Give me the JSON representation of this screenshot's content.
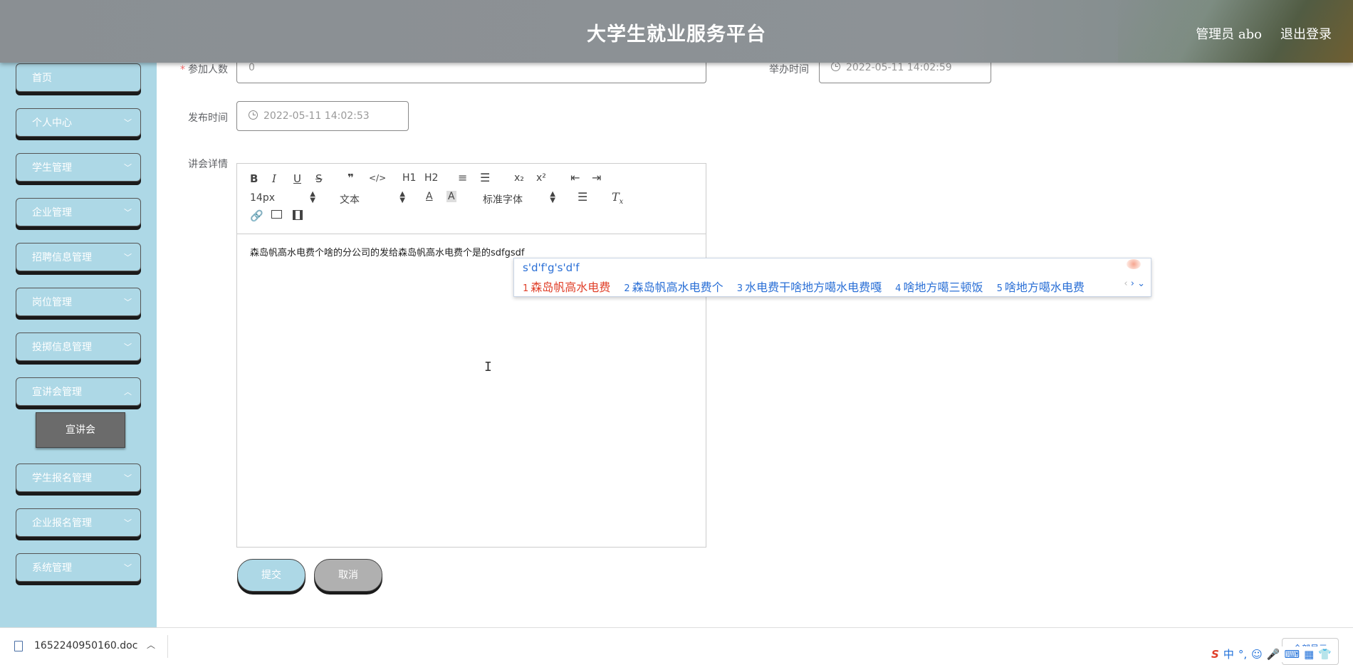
{
  "header": {
    "title": "大学生就业服务平台",
    "user": "管理员 abo",
    "logout": "退出登录"
  },
  "sidebar": {
    "items": [
      {
        "label": "首页",
        "has_chevron": false
      },
      {
        "label": "个人中心",
        "has_chevron": true
      },
      {
        "label": "学生管理",
        "has_chevron": true
      },
      {
        "label": "企业管理",
        "has_chevron": true
      },
      {
        "label": "招聘信息管理",
        "has_chevron": true
      },
      {
        "label": "岗位管理",
        "has_chevron": true
      },
      {
        "label": "投掷信息管理",
        "has_chevron": true
      },
      {
        "label": "宣讲会管理",
        "has_chevron": true
      },
      {
        "label": "学生报名管理",
        "has_chevron": true
      },
      {
        "label": "企业报名管理",
        "has_chevron": true
      },
      {
        "label": "系统管理",
        "has_chevron": true
      }
    ],
    "active_submenu": "宣讲会"
  },
  "form": {
    "participants": {
      "label": "参加人数",
      "required_mark": "*",
      "value": "0"
    },
    "hold_time": {
      "label": "举办时间",
      "value": "2022-05-11 14:02:59"
    },
    "publish_time": {
      "label": "发布时间",
      "value": "2022-05-11 14:02:53"
    },
    "details": {
      "label": "讲会详情"
    }
  },
  "editor": {
    "toolbar": {
      "row1": [
        "B",
        "I",
        "U",
        "S",
        "❞",
        "</>",
        "H1",
        "H2",
        "≡",
        "☰",
        "x₂",
        "x²",
        "⇤",
        "⇥"
      ],
      "font_size": "14px",
      "block_format": "文本",
      "font_family": "标准字体"
    },
    "content": "森岛帆高水电费个啥的分公司的发给森岛帆高水电费个是的sdfgsdf"
  },
  "buttons": {
    "submit": "提交",
    "cancel": "取消"
  },
  "ime": {
    "input": "s'd'f'g's'd'f",
    "candidates": [
      {
        "num": "1",
        "text": "森岛帆高水电费"
      },
      {
        "num": "2",
        "text": "森岛帆高水电费个"
      },
      {
        "num": "3",
        "text": "水电费干啥地方噶水电费嘎"
      },
      {
        "num": "4",
        "text": "啥地方噶三顿饭"
      },
      {
        "num": "5",
        "text": "啥地方噶水电费"
      }
    ]
  },
  "download_bar": {
    "file": "1652240950160.doc",
    "show_all": "全部显示"
  },
  "tray": {
    "lang": "中"
  },
  "colors": {
    "sidebar_bg": "#add8e6",
    "header_bg": "#8d9296",
    "submenu_bg": "#6b6b6b",
    "cancel_bg": "#b0b0b0",
    "ime_first": "#e0402a",
    "ime_text": "#2a6fd6"
  }
}
